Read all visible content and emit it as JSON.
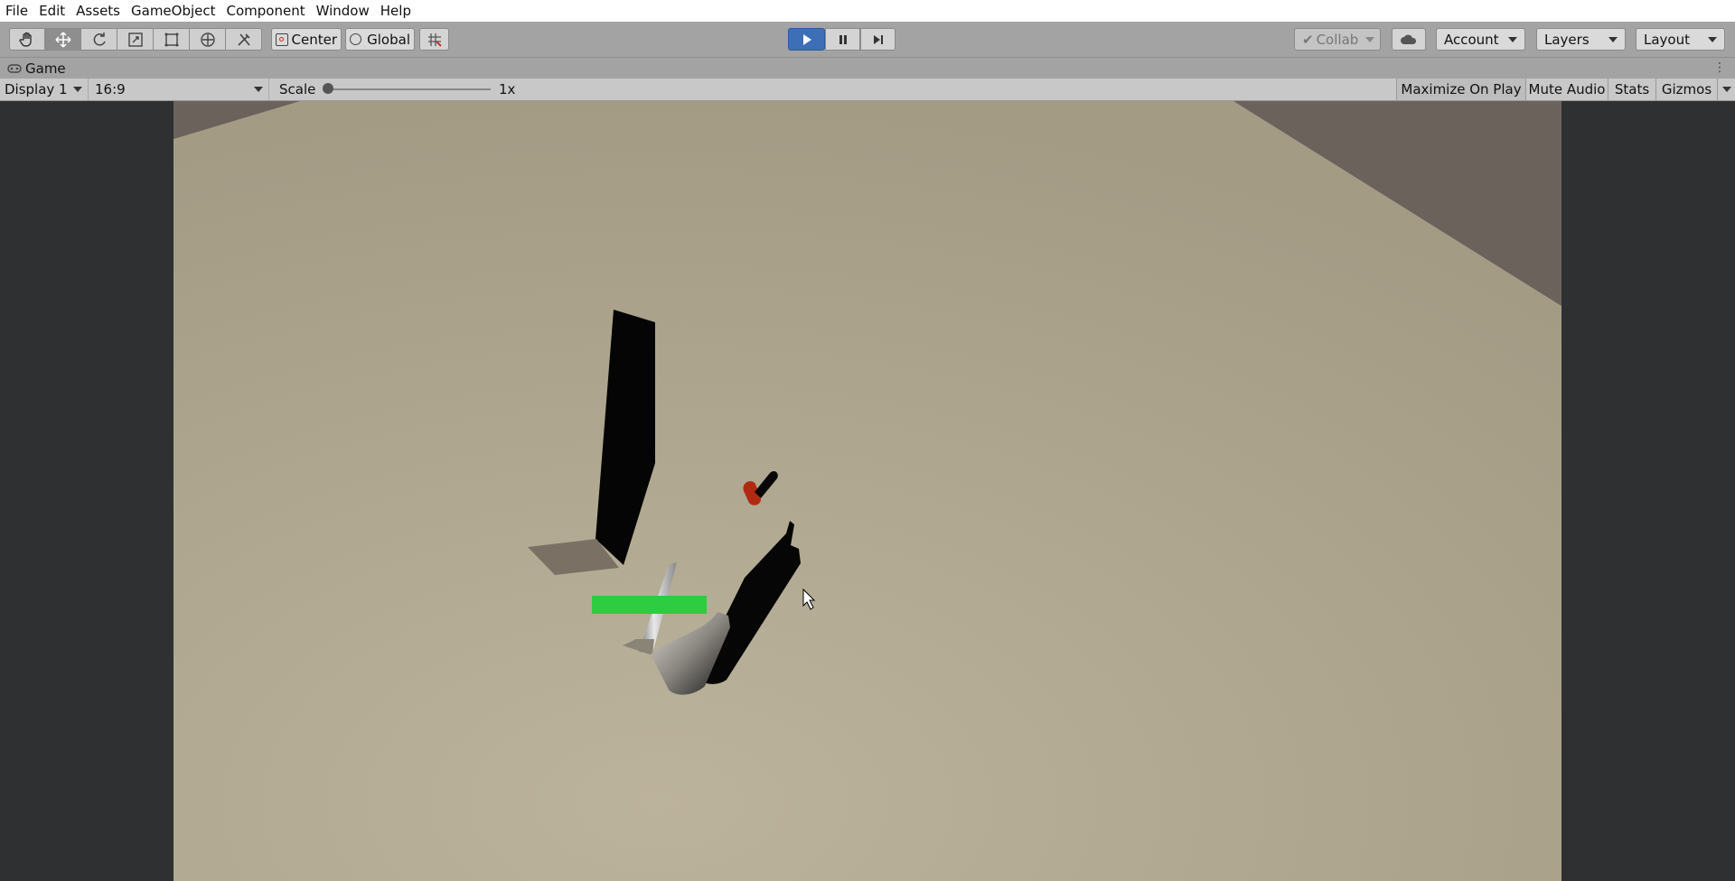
{
  "menu": [
    "File",
    "Edit",
    "Assets",
    "GameObject",
    "Component",
    "Window",
    "Help"
  ],
  "toolbar": {
    "tools": [
      {
        "name": "hand-tool",
        "icon": "hand-icon",
        "active": false
      },
      {
        "name": "move-tool",
        "icon": "move-icon",
        "active": true
      },
      {
        "name": "rotate-tool",
        "icon": "rotate-icon",
        "active": false
      },
      {
        "name": "scale-tool",
        "icon": "scale-icon",
        "active": false
      },
      {
        "name": "rect-tool",
        "icon": "rect-icon",
        "active": false
      },
      {
        "name": "transform-tool",
        "icon": "transform-icon",
        "active": false
      },
      {
        "name": "custom-tool",
        "icon": "tools-icon",
        "active": false
      }
    ],
    "pivot_label": "Center",
    "space_label": "Global",
    "collab_label": "Collab",
    "account_label": "Account",
    "layers_label": "Layers",
    "layout_label": "Layout"
  },
  "game_tab": {
    "label": "Game",
    "display": "Display 1",
    "aspect": "16:9",
    "scale_label": "Scale",
    "scale_value": "1x",
    "maximize_label": "Maximize On Play",
    "mute_label": "Mute Audio",
    "stats_label": "Stats",
    "gizmos_label": "Gizmos"
  },
  "colors": {
    "play_active": "#3d6fb6",
    "health_bar": "#2ecc40",
    "ground": "#aca38b",
    "wall": "#6c625c",
    "red_object": "#b02a12"
  }
}
